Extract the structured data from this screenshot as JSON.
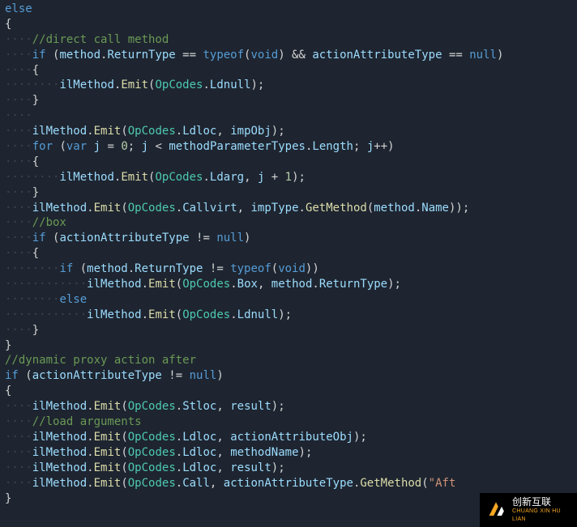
{
  "code": {
    "lines": [
      {
        "indent": 0,
        "segments": [
          [
            "kw",
            "else"
          ]
        ]
      },
      {
        "indent": 0,
        "segments": [
          [
            "pn",
            "{"
          ]
        ]
      },
      {
        "indent": 1,
        "segments": [
          [
            "cm",
            "//direct call method"
          ]
        ]
      },
      {
        "indent": 1,
        "segments": [
          [
            "kw",
            "if"
          ],
          [
            "pn",
            " ("
          ],
          [
            "prop",
            "method"
          ],
          [
            "pn",
            "."
          ],
          [
            "prop",
            "ReturnType"
          ],
          [
            "pn",
            " == "
          ],
          [
            "kw",
            "typeof"
          ],
          [
            "pn",
            "("
          ],
          [
            "kw",
            "void"
          ],
          [
            "pn",
            ") && "
          ],
          [
            "prop",
            "actionAttributeType"
          ],
          [
            "pn",
            " == "
          ],
          [
            "kw",
            "null"
          ],
          [
            "pn",
            ")"
          ]
        ]
      },
      {
        "indent": 1,
        "segments": [
          [
            "pn",
            "{"
          ]
        ]
      },
      {
        "indent": 2,
        "segments": [
          [
            "prop",
            "ilMethod"
          ],
          [
            "pn",
            "."
          ],
          [
            "mn",
            "Emit"
          ],
          [
            "pn",
            "("
          ],
          [
            "cls",
            "OpCodes"
          ],
          [
            "pn",
            "."
          ],
          [
            "prop",
            "Ldnull"
          ],
          [
            "pn",
            ");"
          ]
        ]
      },
      {
        "indent": 1,
        "segments": [
          [
            "pn",
            "}"
          ]
        ]
      },
      {
        "indent": 1,
        "segments": [
          [
            "pn",
            ""
          ]
        ]
      },
      {
        "indent": 1,
        "segments": [
          [
            "prop",
            "ilMethod"
          ],
          [
            "pn",
            "."
          ],
          [
            "mn",
            "Emit"
          ],
          [
            "pn",
            "("
          ],
          [
            "cls",
            "OpCodes"
          ],
          [
            "pn",
            "."
          ],
          [
            "prop",
            "Ldloc"
          ],
          [
            "pn",
            ", "
          ],
          [
            "prop",
            "impObj"
          ],
          [
            "pn",
            ");"
          ]
        ]
      },
      {
        "indent": 1,
        "segments": [
          [
            "kw",
            "for"
          ],
          [
            "pn",
            " ("
          ],
          [
            "kw",
            "var"
          ],
          [
            "pn",
            " "
          ],
          [
            "prop",
            "j"
          ],
          [
            "pn",
            " = "
          ],
          [
            "num",
            "0"
          ],
          [
            "pn",
            "; "
          ],
          [
            "prop",
            "j"
          ],
          [
            "pn",
            " < "
          ],
          [
            "prop",
            "methodParameterTypes"
          ],
          [
            "pn",
            "."
          ],
          [
            "prop",
            "Length"
          ],
          [
            "pn",
            "; "
          ],
          [
            "prop",
            "j"
          ],
          [
            "pn",
            "++)"
          ]
        ]
      },
      {
        "indent": 1,
        "segments": [
          [
            "pn",
            "{"
          ]
        ]
      },
      {
        "indent": 2,
        "segments": [
          [
            "prop",
            "ilMethod"
          ],
          [
            "pn",
            "."
          ],
          [
            "mn",
            "Emit"
          ],
          [
            "pn",
            "("
          ],
          [
            "cls",
            "OpCodes"
          ],
          [
            "pn",
            "."
          ],
          [
            "prop",
            "Ldarg"
          ],
          [
            "pn",
            ", "
          ],
          [
            "prop",
            "j"
          ],
          [
            "pn",
            " + "
          ],
          [
            "num",
            "1"
          ],
          [
            "pn",
            ");"
          ]
        ]
      },
      {
        "indent": 1,
        "segments": [
          [
            "pn",
            "}"
          ]
        ]
      },
      {
        "indent": 1,
        "segments": [
          [
            "prop",
            "ilMethod"
          ],
          [
            "pn",
            "."
          ],
          [
            "mn",
            "Emit"
          ],
          [
            "pn",
            "("
          ],
          [
            "cls",
            "OpCodes"
          ],
          [
            "pn",
            "."
          ],
          [
            "prop",
            "Callvirt"
          ],
          [
            "pn",
            ", "
          ],
          [
            "prop",
            "impType"
          ],
          [
            "pn",
            "."
          ],
          [
            "mn",
            "GetMethod"
          ],
          [
            "pn",
            "("
          ],
          [
            "prop",
            "method"
          ],
          [
            "pn",
            "."
          ],
          [
            "prop",
            "Name"
          ],
          [
            "pn",
            "));"
          ]
        ]
      },
      {
        "indent": 1,
        "segments": [
          [
            "cm",
            "//box"
          ]
        ]
      },
      {
        "indent": 1,
        "segments": [
          [
            "kw",
            "if"
          ],
          [
            "pn",
            " ("
          ],
          [
            "prop",
            "actionAttributeType"
          ],
          [
            "pn",
            " != "
          ],
          [
            "kw",
            "null"
          ],
          [
            "pn",
            ")"
          ]
        ]
      },
      {
        "indent": 1,
        "segments": [
          [
            "pn",
            "{"
          ]
        ]
      },
      {
        "indent": 2,
        "segments": [
          [
            "kw",
            "if"
          ],
          [
            "pn",
            " ("
          ],
          [
            "prop",
            "method"
          ],
          [
            "pn",
            "."
          ],
          [
            "prop",
            "ReturnType"
          ],
          [
            "pn",
            " != "
          ],
          [
            "kw",
            "typeof"
          ],
          [
            "pn",
            "("
          ],
          [
            "kw",
            "void"
          ],
          [
            "pn",
            "))"
          ]
        ]
      },
      {
        "indent": 3,
        "segments": [
          [
            "prop",
            "ilMethod"
          ],
          [
            "pn",
            "."
          ],
          [
            "mn",
            "Emit"
          ],
          [
            "pn",
            "("
          ],
          [
            "cls",
            "OpCodes"
          ],
          [
            "pn",
            "."
          ],
          [
            "prop",
            "Box"
          ],
          [
            "pn",
            ", "
          ],
          [
            "prop",
            "method"
          ],
          [
            "pn",
            "."
          ],
          [
            "prop",
            "ReturnType"
          ],
          [
            "pn",
            ");"
          ]
        ]
      },
      {
        "indent": 2,
        "segments": [
          [
            "kw",
            "else"
          ]
        ]
      },
      {
        "indent": 3,
        "segments": [
          [
            "prop",
            "ilMethod"
          ],
          [
            "pn",
            "."
          ],
          [
            "mn",
            "Emit"
          ],
          [
            "pn",
            "("
          ],
          [
            "cls",
            "OpCodes"
          ],
          [
            "pn",
            "."
          ],
          [
            "prop",
            "Ldnull"
          ],
          [
            "pn",
            ");"
          ]
        ]
      },
      {
        "indent": 1,
        "segments": [
          [
            "pn",
            "}"
          ]
        ]
      },
      {
        "indent": 0,
        "segments": [
          [
            "pn",
            "}"
          ]
        ]
      },
      {
        "indent": 0,
        "segments": [
          [
            "pn",
            ""
          ]
        ]
      },
      {
        "indent": 0,
        "segments": [
          [
            "cm",
            "//dynamic proxy action after"
          ]
        ]
      },
      {
        "indent": 0,
        "segments": [
          [
            "kw",
            "if"
          ],
          [
            "pn",
            " ("
          ],
          [
            "prop",
            "actionAttributeType"
          ],
          [
            "pn",
            " != "
          ],
          [
            "kw",
            "null"
          ],
          [
            "pn",
            ")"
          ]
        ]
      },
      {
        "indent": 0,
        "segments": [
          [
            "pn",
            "{"
          ]
        ]
      },
      {
        "indent": 1,
        "segments": [
          [
            "prop",
            "ilMethod"
          ],
          [
            "pn",
            "."
          ],
          [
            "mn",
            "Emit"
          ],
          [
            "pn",
            "("
          ],
          [
            "cls",
            "OpCodes"
          ],
          [
            "pn",
            "."
          ],
          [
            "prop",
            "Stloc"
          ],
          [
            "pn",
            ", "
          ],
          [
            "prop",
            "result"
          ],
          [
            "pn",
            ");"
          ]
        ]
      },
      {
        "indent": 1,
        "segments": [
          [
            "cm",
            "//load arguments"
          ]
        ]
      },
      {
        "indent": 1,
        "segments": [
          [
            "prop",
            "ilMethod"
          ],
          [
            "pn",
            "."
          ],
          [
            "mn",
            "Emit"
          ],
          [
            "pn",
            "("
          ],
          [
            "cls",
            "OpCodes"
          ],
          [
            "pn",
            "."
          ],
          [
            "prop",
            "Ldloc"
          ],
          [
            "pn",
            ", "
          ],
          [
            "prop",
            "actionAttributeObj"
          ],
          [
            "pn",
            ");"
          ]
        ]
      },
      {
        "indent": 1,
        "segments": [
          [
            "prop",
            "ilMethod"
          ],
          [
            "pn",
            "."
          ],
          [
            "mn",
            "Emit"
          ],
          [
            "pn",
            "("
          ],
          [
            "cls",
            "OpCodes"
          ],
          [
            "pn",
            "."
          ],
          [
            "prop",
            "Ldloc"
          ],
          [
            "pn",
            ", "
          ],
          [
            "prop",
            "methodName"
          ],
          [
            "pn",
            ");"
          ]
        ]
      },
      {
        "indent": 1,
        "segments": [
          [
            "prop",
            "ilMethod"
          ],
          [
            "pn",
            "."
          ],
          [
            "mn",
            "Emit"
          ],
          [
            "pn",
            "("
          ],
          [
            "cls",
            "OpCodes"
          ],
          [
            "pn",
            "."
          ],
          [
            "prop",
            "Ldloc"
          ],
          [
            "pn",
            ", "
          ],
          [
            "prop",
            "result"
          ],
          [
            "pn",
            ");"
          ]
        ]
      },
      {
        "indent": 1,
        "segments": [
          [
            "prop",
            "ilMethod"
          ],
          [
            "pn",
            "."
          ],
          [
            "mn",
            "Emit"
          ],
          [
            "pn",
            "("
          ],
          [
            "cls",
            "OpCodes"
          ],
          [
            "pn",
            "."
          ],
          [
            "prop",
            "Call"
          ],
          [
            "pn",
            ", "
          ],
          [
            "prop",
            "actionAttributeType"
          ],
          [
            "pn",
            "."
          ],
          [
            "mn",
            "GetMethod"
          ],
          [
            "pn",
            "("
          ],
          [
            "str",
            "\"Aft"
          ]
        ]
      },
      {
        "indent": 0,
        "segments": [
          [
            "pn",
            "}"
          ]
        ]
      }
    ]
  },
  "logo": {
    "title": "创新互联",
    "subtitle": "CHUANG XIN HU LIAN"
  }
}
